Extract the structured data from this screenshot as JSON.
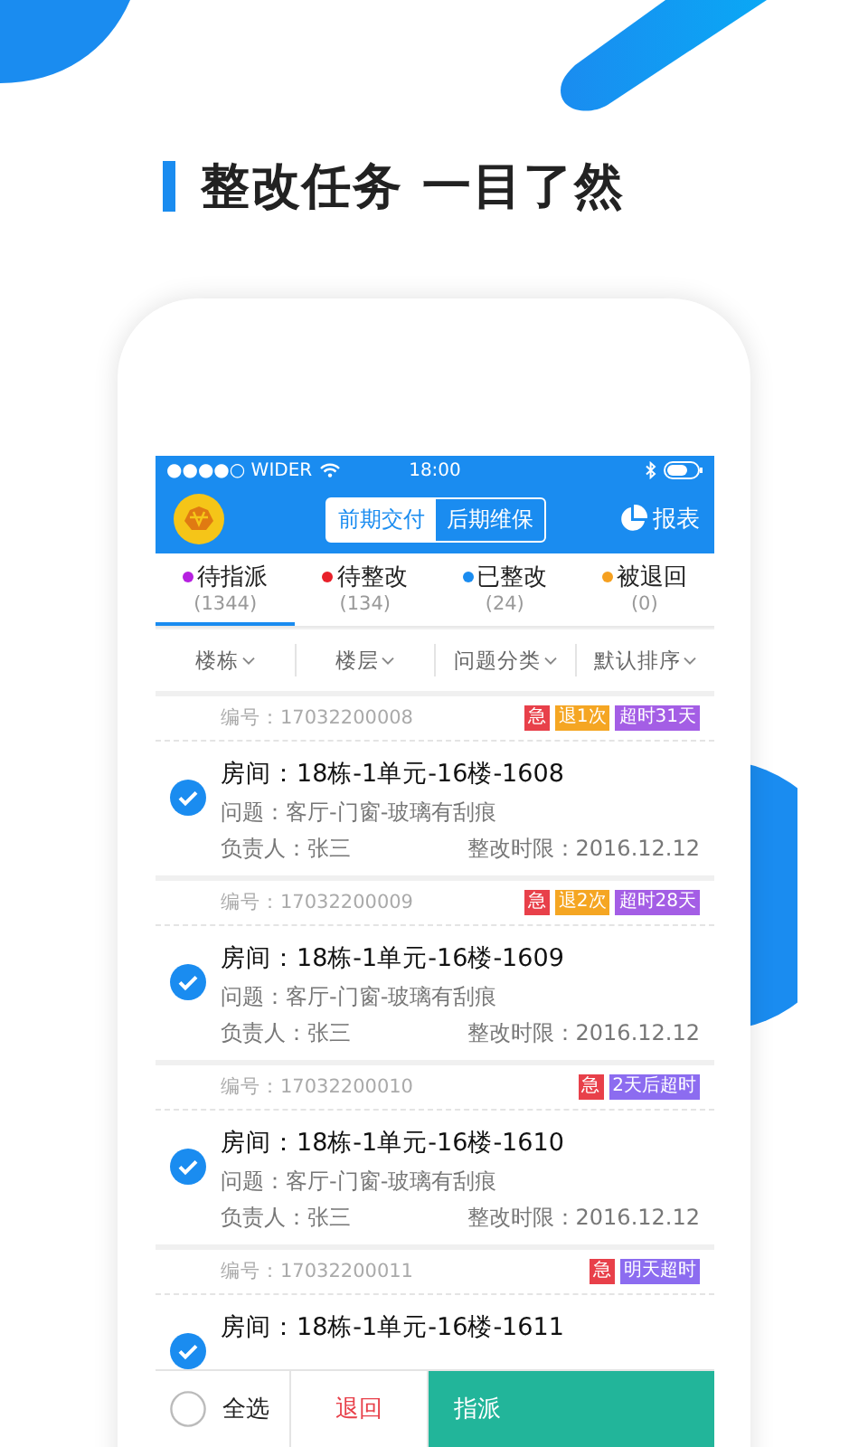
{
  "headline": "整改任务 一目了然",
  "status_bar": {
    "carrier": "●●●●○ WIDER",
    "time": "18:00"
  },
  "nav": {
    "segments": [
      {
        "label": "前期交付",
        "selected": true
      },
      {
        "label": "后期维保",
        "selected": false
      }
    ],
    "report": "报表"
  },
  "tabs": [
    {
      "label": "待指派",
      "count": "(1344)",
      "color": "#b620e0",
      "selected": true
    },
    {
      "label": "待整改",
      "count": "(134)",
      "color": "#e8202a",
      "selected": false
    },
    {
      "label": "已整改",
      "count": "(24)",
      "color": "#1a8cf0",
      "selected": false
    },
    {
      "label": "被退回",
      "count": "(0)",
      "color": "#f5a020",
      "selected": false
    }
  ],
  "filters": [
    "楼栋",
    "楼层",
    "问题分类",
    "默认排序"
  ],
  "tasks": [
    {
      "number": "编号：17032200008",
      "tags": [
        {
          "text": "急",
          "color": "#e8404a"
        },
        {
          "text": "退1次",
          "color": "#f5a623"
        },
        {
          "text": "超时31天",
          "color": "#a45ee5"
        }
      ],
      "checked": true,
      "room": "房间：18栋-1单元-16楼-1608",
      "problem": "问题：客厅-门窗-玻璃有刮痕",
      "owner": "负责人：张三",
      "deadline": "整改时限：2016.12.12"
    },
    {
      "number": "编号：17032200009",
      "tags": [
        {
          "text": "急",
          "color": "#e8404a"
        },
        {
          "text": "退2次",
          "color": "#f5a623"
        },
        {
          "text": "超时28天",
          "color": "#a45ee5"
        }
      ],
      "checked": true,
      "room": "房间：18栋-1单元-16楼-1609",
      "problem": "问题：客厅-门窗-玻璃有刮痕",
      "owner": "负责人：张三",
      "deadline": "整改时限：2016.12.12"
    },
    {
      "number": "编号：17032200010",
      "tags": [
        {
          "text": "急",
          "color": "#e8404a"
        },
        {
          "text": "2天后超时",
          "color": "#8c6cf0"
        }
      ],
      "checked": true,
      "room": "房间：18栋-1单元-16楼-1610",
      "problem": "问题：客厅-门窗-玻璃有刮痕",
      "owner": "负责人：张三",
      "deadline": "整改时限：2016.12.12"
    },
    {
      "number": "编号：17032200011",
      "tags": [
        {
          "text": "急",
          "color": "#e8404a"
        },
        {
          "text": "明天超时",
          "color": "#8c6cf0"
        }
      ],
      "checked": true,
      "room": "房间：18栋-1单元-16楼-1611"
    }
  ],
  "footer": {
    "select_all": "全选",
    "select_all_checked": false,
    "return": "退回",
    "assign": "指派"
  }
}
